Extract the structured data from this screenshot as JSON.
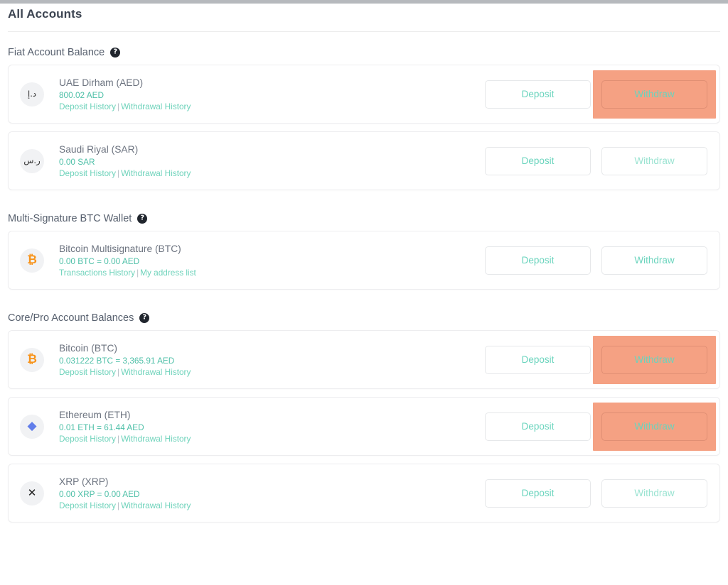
{
  "page": {
    "title": "All Accounts"
  },
  "labels": {
    "deposit": "Deposit",
    "withdraw": "Withdraw",
    "help_glyph": "?",
    "separator": "|"
  },
  "sections": [
    {
      "heading": "Fiat Account Balance",
      "accounts": [
        {
          "icon": "aed-dirham-icon",
          "glyph": "د.إ",
          "glyph_class": "fiat",
          "name": "UAE Dirham (AED)",
          "balance": "800.02 AED",
          "link1": "Deposit History",
          "link2": "Withdrawal History",
          "deposit": "Deposit",
          "withdraw": "Withdraw",
          "withdraw_highlighted": true,
          "withdraw_tone": "dark"
        },
        {
          "icon": "sar-riyal-icon",
          "glyph": "ر.س",
          "glyph_class": "fiat",
          "name": "Saudi Riyal (SAR)",
          "balance": "0.00 SAR",
          "link1": "Deposit History",
          "link2": "Withdrawal History",
          "deposit": "Deposit",
          "withdraw": "Withdraw",
          "withdraw_highlighted": false,
          "withdraw_tone": "muted"
        }
      ]
    },
    {
      "heading": "Multi-Signature BTC Wallet",
      "accounts": [
        {
          "icon": "bitcoin-icon",
          "glyph": "₿",
          "glyph_class": "btc",
          "name": "Bitcoin Multisignature (BTC)",
          "balance": "0.00 BTC = 0.00 AED",
          "link1": "Transactions History",
          "link2": "My address list",
          "deposit": "Deposit",
          "withdraw": "Withdraw",
          "withdraw_highlighted": false,
          "withdraw_tone": "dark"
        }
      ]
    },
    {
      "heading": "Core/Pro Account Balances",
      "accounts": [
        {
          "icon": "bitcoin-icon",
          "glyph": "₿",
          "glyph_class": "btc",
          "name": "Bitcoin (BTC)",
          "balance": "0.031222 BTC = 3,365.91 AED",
          "link1": "Deposit History",
          "link2": "Withdrawal History",
          "deposit": "Deposit",
          "withdraw": "Withdraw",
          "withdraw_highlighted": true,
          "withdraw_tone": "dark"
        },
        {
          "icon": "ethereum-icon",
          "glyph": "◆",
          "glyph_class": "eth",
          "name": "Ethereum (ETH)",
          "balance": "0.01 ETH = 61.44 AED",
          "link1": "Deposit History",
          "link2": "Withdrawal History",
          "deposit": "Deposit",
          "withdraw": "Withdraw",
          "withdraw_highlighted": true,
          "withdraw_tone": "dark"
        },
        {
          "icon": "xrp-icon",
          "glyph": "✕",
          "glyph_class": "xrp",
          "name": "XRP (XRP)",
          "balance": "0.00 XRP = 0.00 AED",
          "link1": "Deposit History",
          "link2": "Withdrawal History",
          "deposit": "Deposit",
          "withdraw": "Withdraw",
          "withdraw_highlighted": false,
          "withdraw_tone": "muted"
        }
      ]
    }
  ],
  "colors": {
    "accent_teal": "#6ad4bd",
    "highlight_salmon": "#f5a183",
    "bitcoin_orange": "#f7931a",
    "ethereum_blue": "#627eea",
    "title_slate": "#3d4552"
  }
}
